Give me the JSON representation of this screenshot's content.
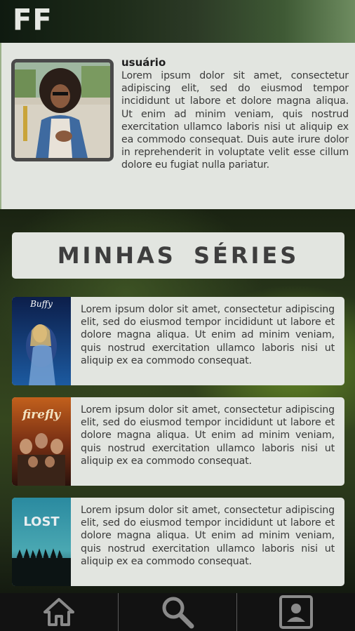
{
  "header": {
    "logo": "FF"
  },
  "profile": {
    "name": "usuário",
    "bio": "Lorem ipsum dolor sit amet, consectetur adipiscing elit, sed do eiusmod tempor incididunt ut labore et dolore magna aliqua. Ut enim ad minim veniam, quis nostrud exercitation ullamco laboris nisi ut aliquip ex ea commodo consequat. Duis aute irure dolor in reprehenderit in voluptate velit esse cillum dolore eu fugiat nulla pariatur."
  },
  "section": {
    "title": "MINHAS SÉRIES"
  },
  "series": [
    {
      "poster_title": "Buffy",
      "description": "Lorem ipsum dolor sit amet, consectetur adipiscing elit, sed do eiusmod tempor incididunt ut labore et dolore magna aliqua. Ut enim ad minim veniam, quis nostrud exercitation ullamco laboris nisi ut aliquip ex ea commodo consequat."
    },
    {
      "poster_title": "firefly",
      "description": "Lorem ipsum dolor sit amet, consectetur adipiscing elit, sed do eiusmod tempor incididunt ut labore et dolore magna aliqua. Ut enim ad minim veniam, quis nostrud exercitation ullamco laboris nisi ut aliquip ex ea commodo consequat."
    },
    {
      "poster_title": "LOST",
      "description": "Lorem ipsum dolor sit amet, consectetur adipiscing elit, sed do eiusmod tempor incididunt ut labore et dolore magna aliqua. Ut enim ad minim veniam, quis nostrud exercitation ullamco laboris nisi ut aliquip ex ea commodo consequat."
    }
  ],
  "nav": {
    "items": [
      {
        "icon": "home-icon"
      },
      {
        "icon": "search-icon"
      },
      {
        "icon": "profile-card-icon"
      }
    ]
  },
  "colors": {
    "panel": "#e2e5e0",
    "nav_bg": "#121212",
    "nav_icon": "#8a8a8a",
    "text": "#3a3a3a"
  }
}
